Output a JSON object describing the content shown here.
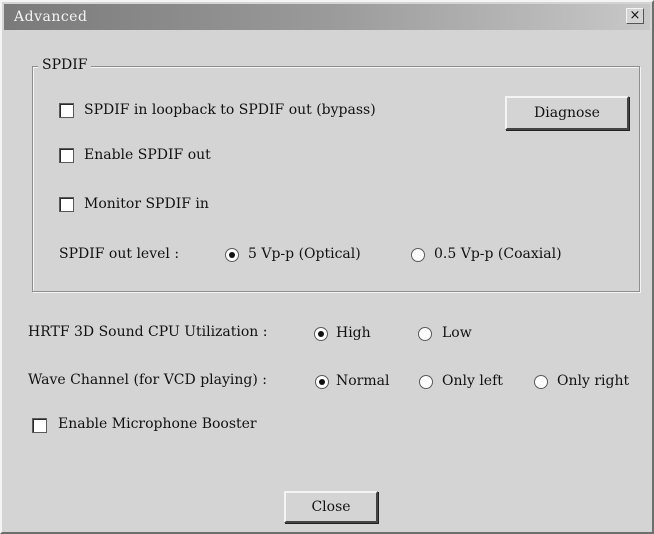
{
  "window": {
    "title": "Advanced",
    "close_glyph": "×"
  },
  "spdif": {
    "legend": "SPDIF",
    "loopback_label": "SPDIF in loopback to SPDIF out (bypass)",
    "enable_out_label": "Enable SPDIF out",
    "monitor_in_label": "Monitor SPDIF in",
    "diagnose_label": "Diagnose",
    "out_level_label": "SPDIF out level :",
    "out_level_options": [
      "5 Vp-p (Optical)",
      "0.5 Vp-p (Coaxial)"
    ],
    "out_level_selected": "5 Vp-p (Optical)"
  },
  "hrtf": {
    "label": "HRTF 3D Sound CPU Utilization :",
    "options": [
      "High",
      "Low"
    ],
    "selected": "High"
  },
  "wave_channel": {
    "label": "Wave Channel (for VCD playing) :",
    "options": [
      "Normal",
      "Only left",
      "Only right"
    ],
    "selected": "Normal"
  },
  "mic_booster_label": "Enable Microphone Booster",
  "close_label": "Close",
  "icons": {
    "close": "close-icon",
    "checkbox": "checkbox-unchecked",
    "radio": "radio-button"
  }
}
